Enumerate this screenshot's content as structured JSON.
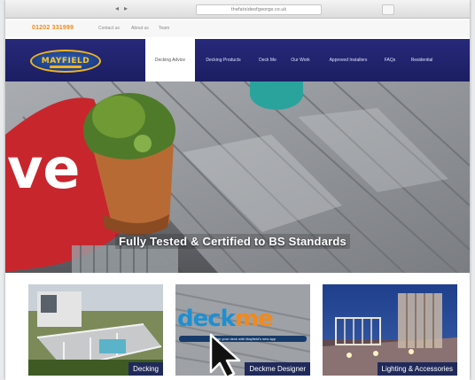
{
  "browser": {
    "url": "thefatsideofgeorge.co.uk"
  },
  "utility": {
    "phone": "01202 331999",
    "links": [
      "Contact us",
      "About us",
      "Team"
    ]
  },
  "header": {
    "logo_text": "MAYFIELD",
    "nav": [
      "Decking Advice",
      "Decking Products",
      "Deck Me",
      "Our Work",
      "Approved Installers",
      "FAQs",
      "Residential"
    ],
    "active_index": 0
  },
  "hero": {
    "caption": "Fully Tested & Certified to BS Standards"
  },
  "tiles": [
    {
      "label": "Decking"
    },
    {
      "label": "Deckme Designer",
      "brand_a": "deck",
      "brand_b": "me",
      "tagline": "Design your deck with Mayfield's new app"
    },
    {
      "label": "Lighting & Accessories"
    }
  ],
  "colors": {
    "nav_bg": "#1e2066",
    "phone": "#f08a1c",
    "logo_gold": "#f0b31e",
    "tile_label_bg": "#202a5a"
  }
}
